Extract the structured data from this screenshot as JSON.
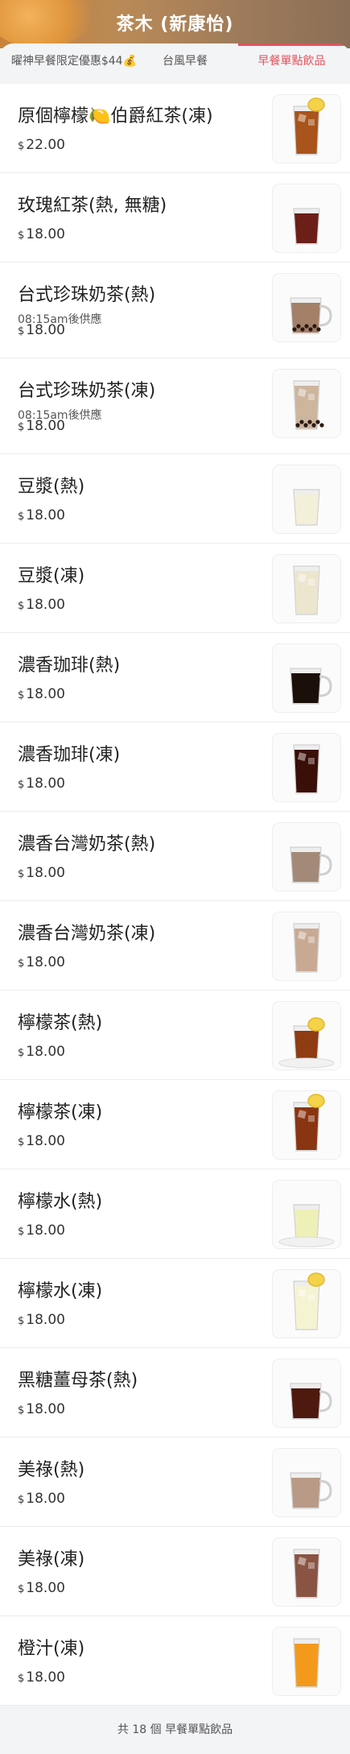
{
  "header": {
    "title": "茶木 (新康怡)"
  },
  "tabs": [
    {
      "label": "曜神早餐限定優惠$44💰"
    },
    {
      "label": "台風早餐"
    },
    {
      "label": "早餐單點飲品"
    }
  ],
  "currency": "$",
  "items": [
    {
      "name": "原個檸檬🍋伯爵紅茶(凍)",
      "price": "22.00",
      "note": "",
      "drink": "lemon-tea-iced"
    },
    {
      "name": "玫瑰紅茶(熱, 無糖)",
      "price": "18.00",
      "note": "",
      "drink": "rose-tea"
    },
    {
      "name": "台式珍珠奶茶(熱)",
      "price": "18.00",
      "note": "08:15am後供應",
      "drink": "bubble-tea-hot"
    },
    {
      "name": "台式珍珠奶茶(凍)",
      "price": "18.00",
      "note": "08:15am後供應",
      "drink": "bubble-tea-iced"
    },
    {
      "name": "豆漿(熱)",
      "price": "18.00",
      "note": "",
      "drink": "soy-hot"
    },
    {
      "name": "豆漿(凍)",
      "price": "18.00",
      "note": "",
      "drink": "soy-iced"
    },
    {
      "name": "濃香珈琲(熱)",
      "price": "18.00",
      "note": "",
      "drink": "coffee-hot"
    },
    {
      "name": "濃香珈琲(凍)",
      "price": "18.00",
      "note": "",
      "drink": "coffee-iced"
    },
    {
      "name": "濃香台灣奶茶(熱)",
      "price": "18.00",
      "note": "",
      "drink": "milk-tea-hot"
    },
    {
      "name": "濃香台灣奶茶(凍)",
      "price": "18.00",
      "note": "",
      "drink": "milk-tea-iced"
    },
    {
      "name": "檸檬茶(熱)",
      "price": "18.00",
      "note": "",
      "drink": "lemon-tea-hot"
    },
    {
      "name": "檸檬茶(凍)",
      "price": "18.00",
      "note": "",
      "drink": "lemon-tea-iced2"
    },
    {
      "name": "檸檬水(熱)",
      "price": "18.00",
      "note": "",
      "drink": "lemon-water-hot"
    },
    {
      "name": "檸檬水(凍)",
      "price": "18.00",
      "note": "",
      "drink": "lemon-water-iced"
    },
    {
      "name": "黑糖薑母茶(熱)",
      "price": "18.00",
      "note": "",
      "drink": "ginger-tea"
    },
    {
      "name": "美祿(熱)",
      "price": "18.00",
      "note": "",
      "drink": "milo-hot"
    },
    {
      "name": "美祿(凍)",
      "price": "18.00",
      "note": "",
      "drink": "milo-iced"
    },
    {
      "name": "橙汁(凍)",
      "price": "18.00",
      "note": "",
      "drink": "orange-juice"
    }
  ],
  "footer": {
    "text": "共 18 個 早餐單點飲品"
  },
  "colors": {
    "accent": "#e2525c"
  }
}
